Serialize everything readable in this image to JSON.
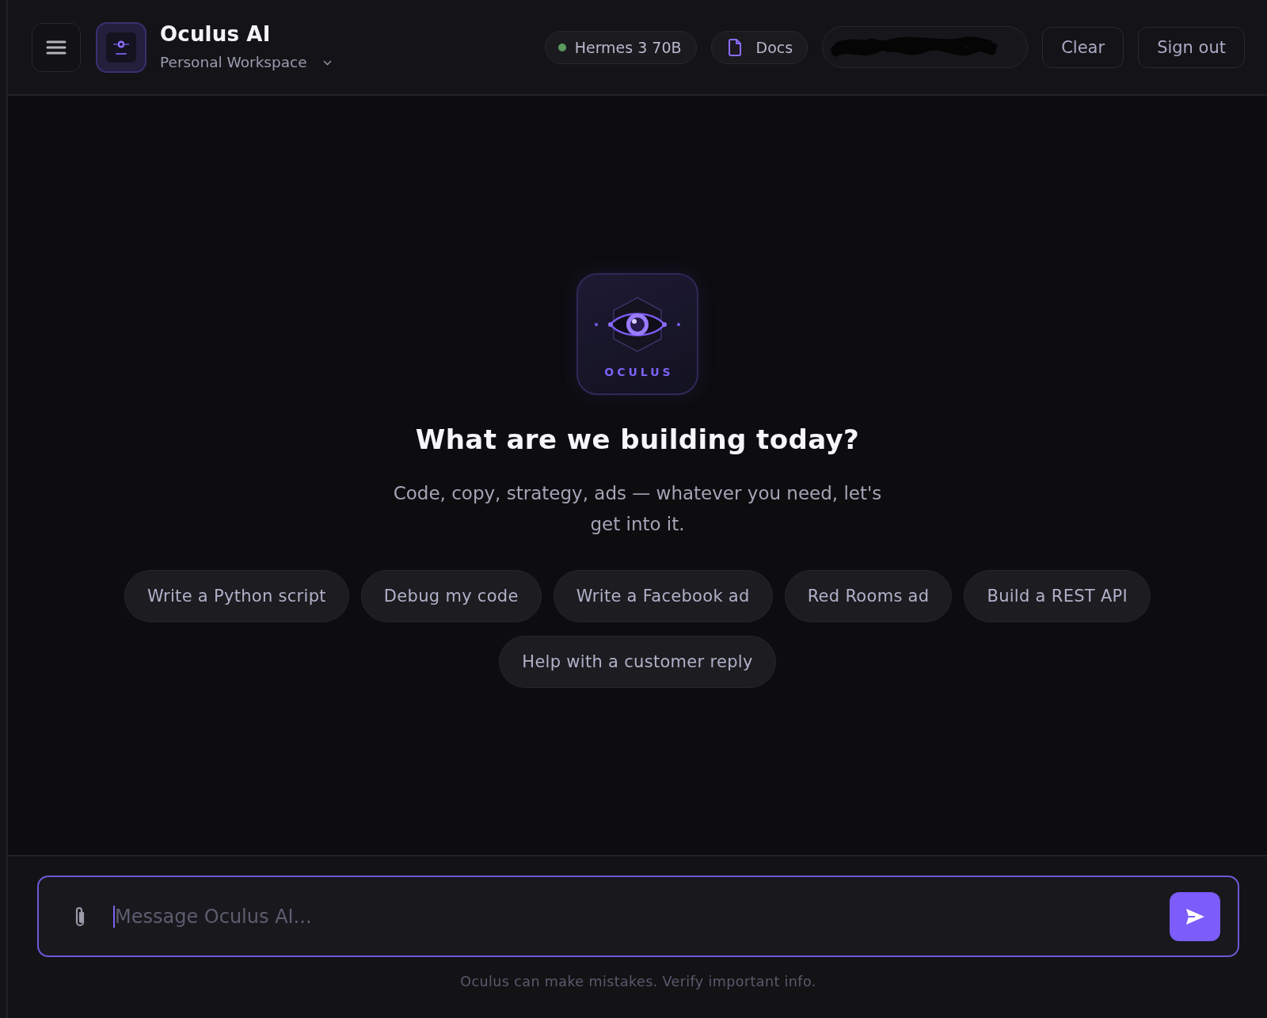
{
  "header": {
    "app_title": "Oculus AI",
    "workspace": "Personal Workspace",
    "model": {
      "label": "Hermes 3 70B",
      "online": true
    },
    "docs_label": "Docs",
    "redacted_pill": {
      "redacted": true
    },
    "buttons": [
      "Clear",
      "Sign out"
    ]
  },
  "hero": {
    "wordmark": "OCULUS",
    "heading": "What are we building today?",
    "subtitle": "Code, copy, strategy, ads — whatever you need, let's get into it."
  },
  "suggestions": [
    "Write a Python script",
    "Debug my code",
    "Write a Facebook ad",
    "Red Rooms ad",
    "Build a REST API",
    "Help with a customer reply"
  ],
  "composer": {
    "placeholder": "Message Oculus AI...",
    "focused": true
  },
  "disclaimer": "Oculus can make mistakes. Verify important info."
}
